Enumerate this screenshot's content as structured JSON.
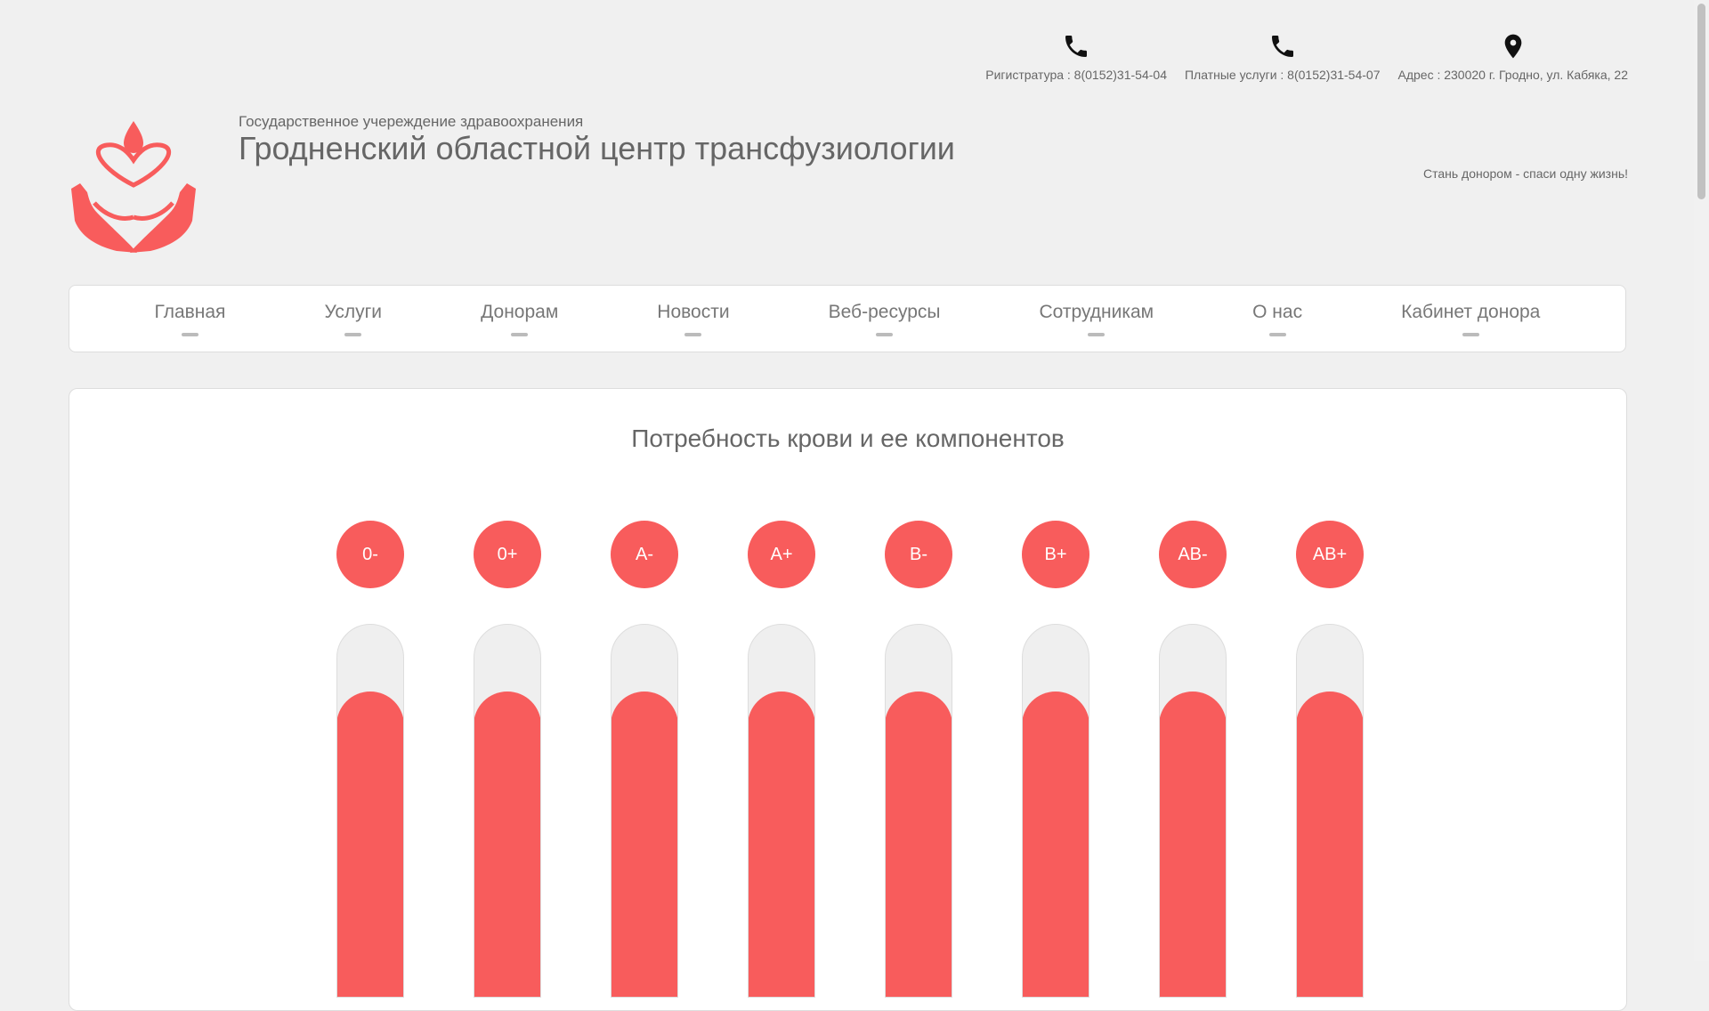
{
  "header": {
    "contacts": [
      {
        "icon": "phone-icon",
        "text": "Ригистратура : 8(0152)31-54-04"
      },
      {
        "icon": "phone-icon",
        "text": "Платные услуги : 8(0152)31-54-07"
      },
      {
        "icon": "location-pin-icon",
        "text": "Адрес : 230020 г. Гродно, ул. Кабяка, 22"
      }
    ],
    "org_subtitle": "Государственное учереждение здравоохранения",
    "org_title": "Гродненский областной центр трансфузиологии",
    "slogan": "Стань донором - спаси одну жизнь!"
  },
  "nav": {
    "items": [
      {
        "label": "Главная"
      },
      {
        "label": "Услуги"
      },
      {
        "label": "Донорам"
      },
      {
        "label": "Новости"
      },
      {
        "label": "Веб-ресурсы"
      },
      {
        "label": "Сотрудникам"
      },
      {
        "label": "О нас"
      },
      {
        "label": "Кабинет донора"
      }
    ]
  },
  "blood_need": {
    "title": "Потребность крови и ее компонентов",
    "groups": [
      {
        "label": "0-",
        "level": 0.82
      },
      {
        "label": "0+",
        "level": 0.82
      },
      {
        "label": "A-",
        "level": 0.82
      },
      {
        "label": "A+",
        "level": 0.82
      },
      {
        "label": "B-",
        "level": 0.82
      },
      {
        "label": "B+",
        "level": 0.82
      },
      {
        "label": "AB-",
        "level": 0.82
      },
      {
        "label": "AB+",
        "level": 0.82
      }
    ]
  },
  "colors": {
    "accent": "#f85c5c",
    "background": "#f0f0f0"
  }
}
